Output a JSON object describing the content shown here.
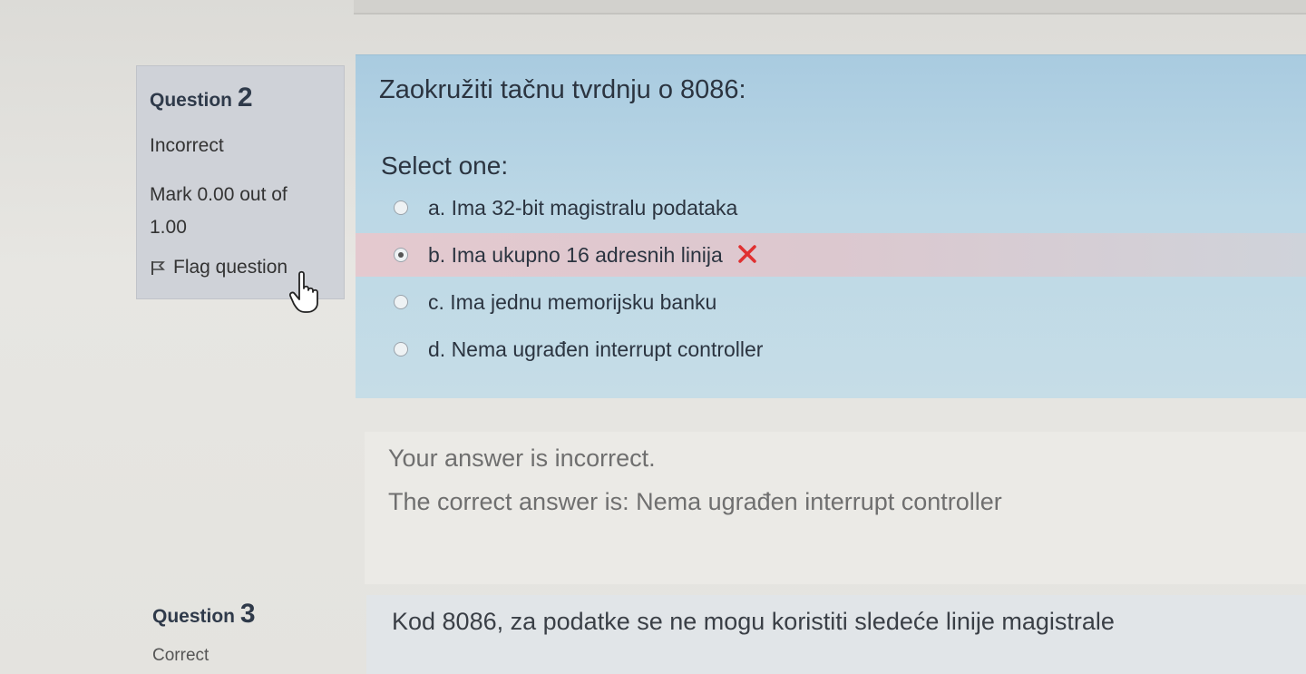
{
  "question2": {
    "label": "Question",
    "number": "2",
    "state": "Incorrect",
    "grade_line1": "Mark 0.00 out of",
    "grade_line2": "1.00",
    "flag_label": "Flag question",
    "text": "Zaokružiti tačnu tvrdnju o 8086:",
    "prompt": "Select one:",
    "options": [
      {
        "label": "a. Ima 32-bit magistralu podataka",
        "selected": false
      },
      {
        "label": "b. Ima ukupno 16 adresnih linija",
        "selected": true,
        "mark_icon": "cross-icon"
      },
      {
        "label": "c. Ima jednu memorijsku banku",
        "selected": false
      },
      {
        "label": "d. Nema ugrađen interrupt controller",
        "selected": false
      }
    ],
    "feedback": {
      "line1": "Your answer is incorrect.",
      "line2": "The correct answer is: Nema ugrađen interrupt controller"
    }
  },
  "question3": {
    "label": "Question",
    "number": "3",
    "state": "Correct",
    "text": "Kod 8086, za podatke se ne mogu koristiti sledeće linije magistrale"
  },
  "colors": {
    "content_bg": "#bcd8e6",
    "info_bg": "#cfd2d8",
    "wrong_row_bg": "#e4c9cf",
    "cross": "#e03030"
  },
  "icons": {
    "flag": "flag-icon",
    "wrong": "cross-icon",
    "cursor": "hand-pointer-icon"
  }
}
